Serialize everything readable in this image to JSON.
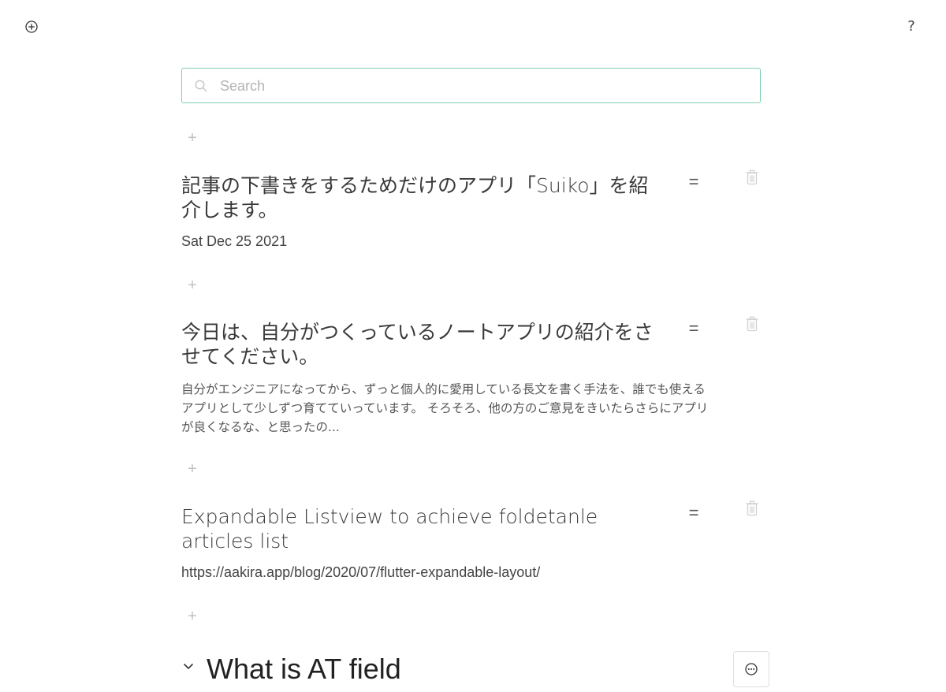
{
  "toolbar": {
    "add_icon": "plus-circle-icon",
    "help_label": "?"
  },
  "search": {
    "placeholder": "Search",
    "value": "",
    "icon": "search-icon"
  },
  "add_note_label": "+",
  "notes": [
    {
      "title": "記事の下書きをするためだけのアプリ「Suiko」を紹介します。",
      "subtitle": "Sat Dec 25 2021",
      "body": "",
      "drag_label": "=",
      "delete_icon": "trash-icon"
    },
    {
      "title": "今日は、自分がつくっているノートアプリの紹介をさせてください。",
      "subtitle": "",
      "body": "自分がエンジニアになってから、ずっと個人的に愛用している長文を書く手法を、誰でも使えるアプリとして少しずつ育てていっています。 そろそろ、他の方のご意見をきいたらさらにアプリが良くなるな、と思ったの...",
      "drag_label": "=",
      "delete_icon": "trash-icon"
    },
    {
      "title": "Expandable Listview to achieve foldetanle articles list",
      "subtitle": "https://aakira.app/blog/2020/07/flutter-expandable-layout/",
      "body": "",
      "drag_label": "=",
      "delete_icon": "trash-icon"
    }
  ],
  "section": {
    "title": "What is AT field",
    "collapse_icon": "chevron-down-icon",
    "more_icon": "more-options-icon"
  },
  "colors": {
    "search_border": "#7fd0ae",
    "text": "#3a3a3a",
    "muted": "#c0c0c0"
  }
}
